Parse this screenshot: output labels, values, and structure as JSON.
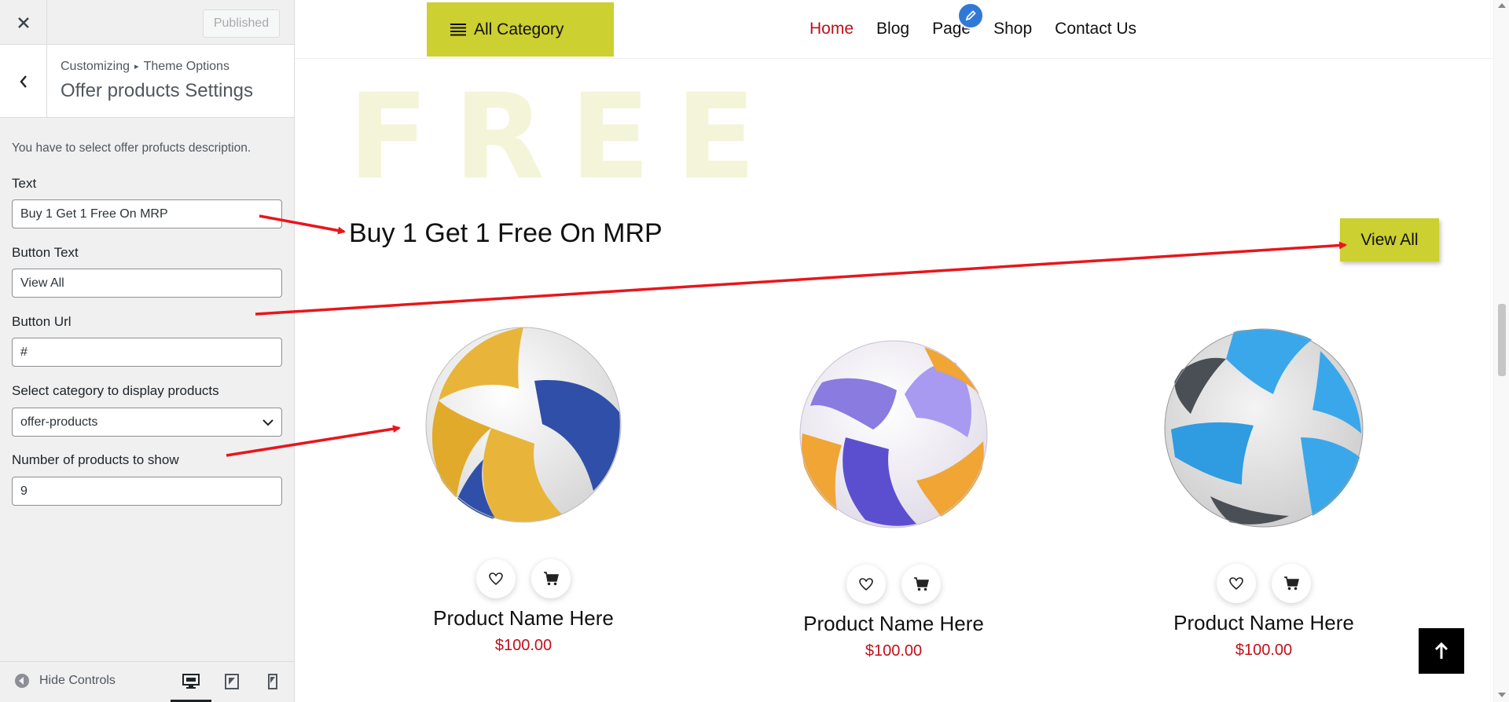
{
  "header": {
    "close_icon": "close-icon",
    "published_label": "Published"
  },
  "panel": {
    "breadcrumb_root": "Customizing",
    "breadcrumb_section": "Theme Options",
    "title": "Offer products Settings",
    "description": "You have to select offer profucts description."
  },
  "fields": {
    "text_label": "Text",
    "text_value": "Buy 1 Get 1 Free On MRP",
    "button_text_label": "Button Text",
    "button_text_value": "View All",
    "button_url_label": "Button Url",
    "button_url_value": "#",
    "category_label": "Select category to display products",
    "category_value": "offer-products",
    "count_label": "Number of products to show",
    "count_value": "9"
  },
  "footer": {
    "hide_controls_label": "Hide Controls",
    "devices": [
      "desktop-icon",
      "tablet-icon",
      "mobile-icon"
    ]
  },
  "site": {
    "all_category_label": "All Category",
    "menu": [
      {
        "label": "Home",
        "active": true
      },
      {
        "label": "Blog",
        "active": false
      },
      {
        "label": "Page",
        "active": false
      },
      {
        "label": "Shop",
        "active": false
      },
      {
        "label": "Contact Us",
        "active": false
      }
    ],
    "bg_word": "FREE",
    "offer_text": "Buy 1 Get 1 Free On MRP",
    "view_all_label": "View All",
    "products": [
      {
        "name": "Product Name Here",
        "price": "$100.00",
        "ball": "yellow-blue"
      },
      {
        "name": "Product Name Here",
        "price": "$100.00",
        "ball": "purple-orange"
      },
      {
        "name": "Product Name Here",
        "price": "$100.00",
        "ball": "sky-blue"
      }
    ]
  },
  "colors": {
    "accent": "#ccd030",
    "active_menu": "#c0101a",
    "price": "#c0101a",
    "annotation_arrow": "#e8161b"
  }
}
